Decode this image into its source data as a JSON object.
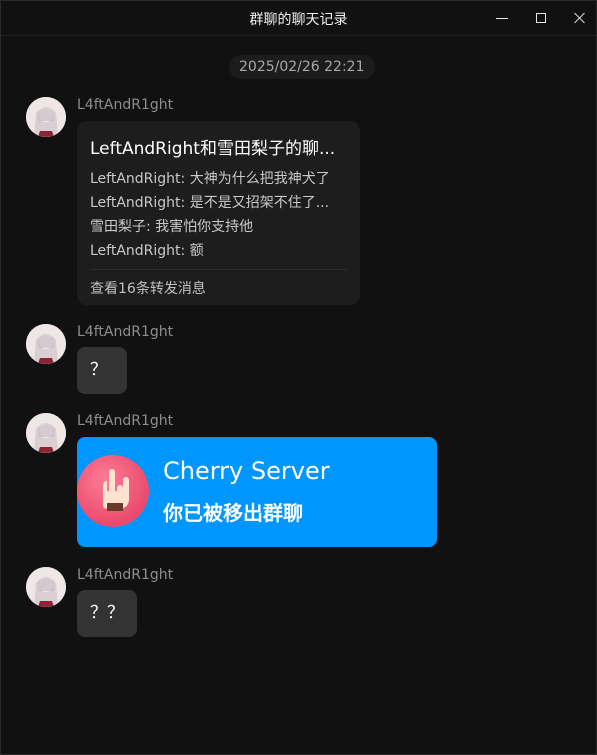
{
  "window": {
    "title": "群聊的聊天记录"
  },
  "timestamp": "2025/02/26 22:21",
  "messages": [
    {
      "sender": "L4ftAndR1ght",
      "type": "forward",
      "card_title": "LeftAndRight和雪田梨子的聊...",
      "lines": [
        "LeftAndRight: 大神为什么把我神犬了",
        "LeftAndRight: 是不是又招架不住了...",
        "雪田梨子: 我害怕你支持他",
        "LeftAndRight: 额"
      ],
      "footer": "查看16条转发消息"
    },
    {
      "sender": "L4ftAndR1ght",
      "type": "text",
      "text": "？"
    },
    {
      "sender": "L4ftAndR1ght",
      "type": "card",
      "server_name": "Cherry Server",
      "notice": "你已被移出群聊",
      "accent": "#0096ff"
    },
    {
      "sender": "L4ftAndR1ght",
      "type": "text",
      "text": "？？"
    }
  ]
}
